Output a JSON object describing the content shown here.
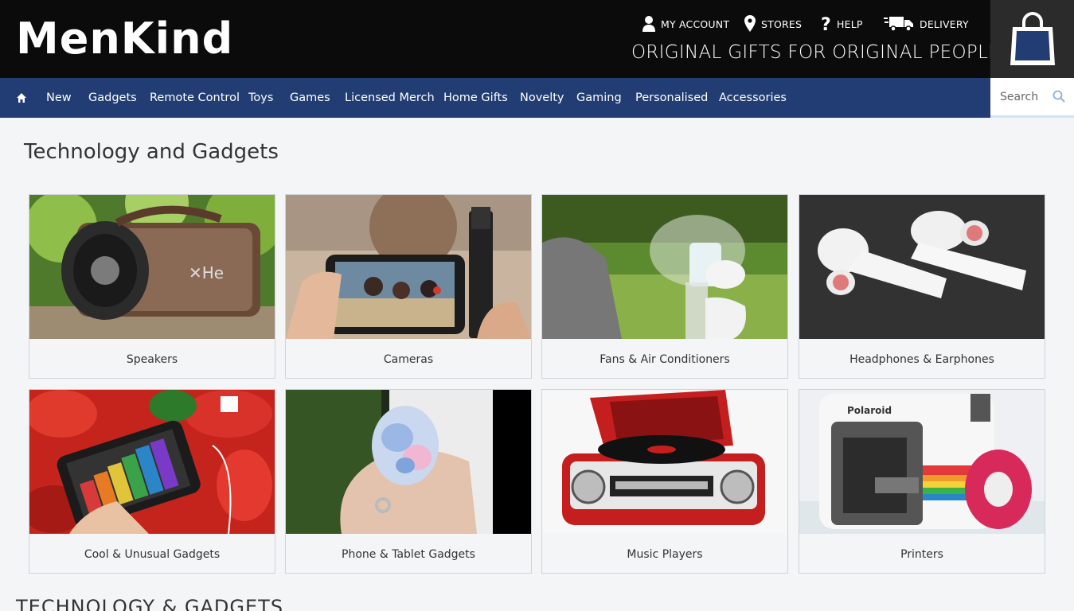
{
  "brand": {
    "logo_text": "MenKind",
    "tagline": "ORIGINAL GIFTS FOR ORIGINAL PEOPLE"
  },
  "utility_links": [
    {
      "label": "MY ACCOUNT",
      "icon": "user-icon"
    },
    {
      "label": "STORES",
      "icon": "map-pin-icon"
    },
    {
      "label": "HELP",
      "icon": "question-icon"
    },
    {
      "label": "DELIVERY",
      "icon": "delivery-truck-icon"
    }
  ],
  "basket": {
    "icon": "shopping-bag-icon"
  },
  "nav": {
    "home_icon": "home-icon",
    "items": [
      "New",
      "Gadgets",
      "Remote Control",
      "Toys",
      "Games",
      "Licensed Merch",
      "Home Gifts",
      "Novelty",
      "Gaming",
      "Personalised",
      "Accessories"
    ]
  },
  "search": {
    "placeholder": "Search",
    "icon": "search-icon"
  },
  "page": {
    "title": "Technology and Gadgets",
    "section_heading": "TECHNOLOGY & GADGETS"
  },
  "categories": [
    {
      "label": "Speakers"
    },
    {
      "label": "Cameras"
    },
    {
      "label": "Fans & Air Conditioners"
    },
    {
      "label": "Headphones & Earphones"
    },
    {
      "label": "Cool & Unusual Gadgets"
    },
    {
      "label": "Phone & Tablet Gadgets"
    },
    {
      "label": "Music Players"
    },
    {
      "label": "Printers"
    }
  ],
  "colors": {
    "header_bg": "#0b0b0b",
    "nav_bg": "#213d73",
    "basket_bg": "#2b2b2b",
    "page_bg": "#f4f5f7"
  }
}
